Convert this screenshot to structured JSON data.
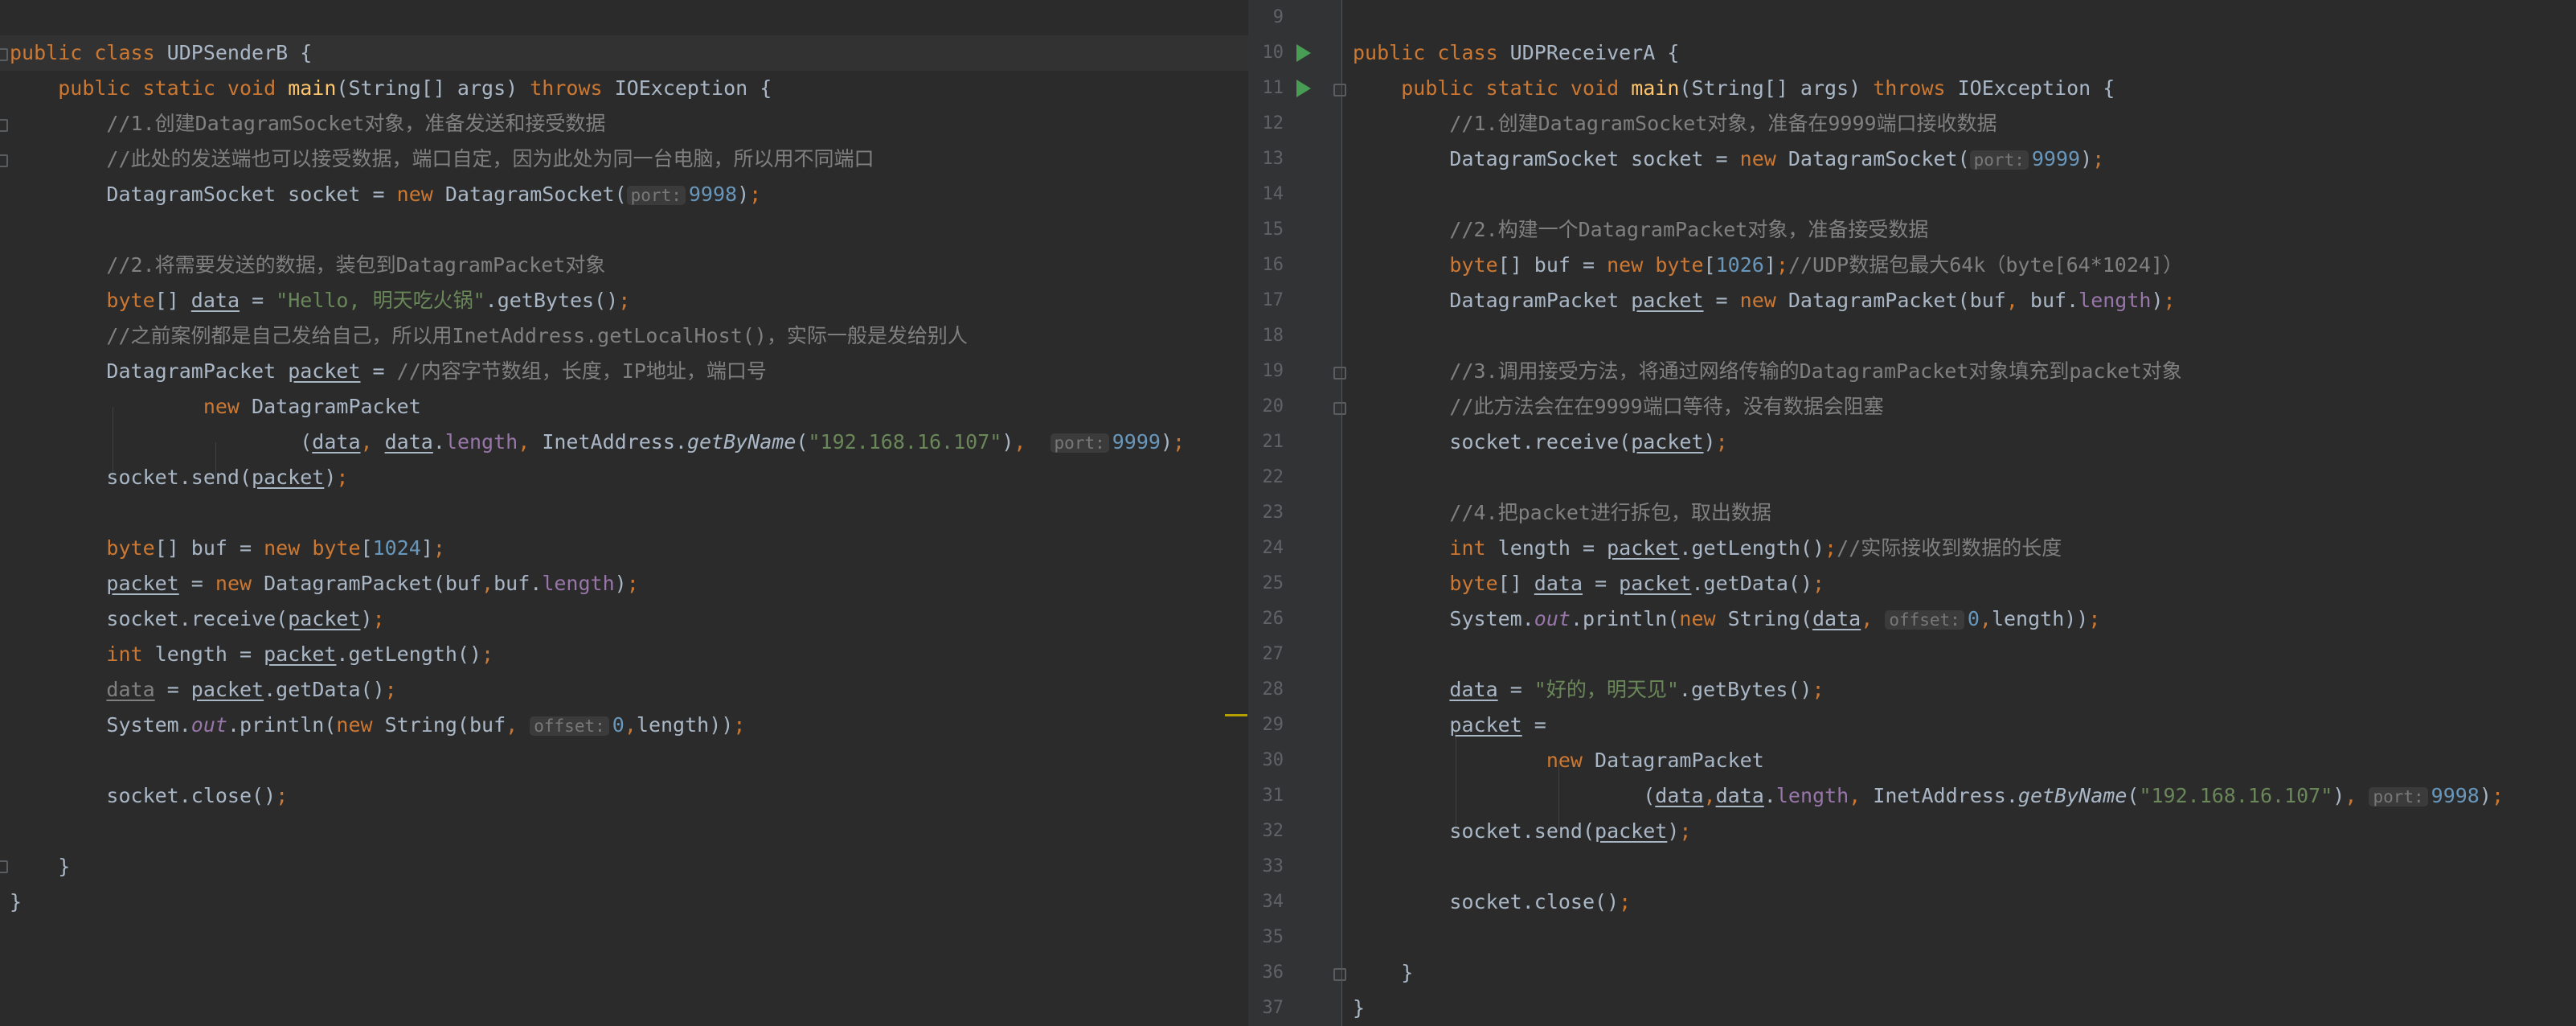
{
  "left_editor": {
    "class_name": "UDPSenderB",
    "comments": {
      "c1": "//1.创建DatagramSocket对象，准备发送和接受数据",
      "c2": "//此处的发送端也可以接受数据，端口自定，因为此处为同一台电脑，所以用不同端口",
      "c3": "//2.将需要发送的数据，装包到DatagramPacket对象",
      "c4": "//之前案例都是自己发给自己，所以用InetAddress.getLocalHost()，实际一般是发给别人",
      "c5": "//内容字节数组，长度，IP地址，端口号"
    },
    "strings": {
      "hello": "\"Hello, 明天吃火锅\"",
      "ip": "\"192.168.16.107\""
    },
    "numbers": {
      "port_socket": "9998",
      "port_send": "9999",
      "buf_size": "1024",
      "offset": "0"
    },
    "hints": {
      "port": "port:",
      "offset": "offset:"
    }
  },
  "right_editor": {
    "class_name": "UDPReceiverA",
    "line_numbers": [
      "9",
      "10",
      "11",
      "12",
      "13",
      "14",
      "15",
      "16",
      "17",
      "18",
      "19",
      "20",
      "21",
      "22",
      "23",
      "24",
      "25",
      "26",
      "27",
      "28",
      "29",
      "30",
      "31",
      "32",
      "33",
      "34",
      "35",
      "36",
      "37"
    ],
    "comments": {
      "c1": "//1.创建DatagramSocket对象，准备在9999端口接收数据",
      "c2": "//2.构建一个DatagramPacket对象，准备接受数据",
      "c3": "//UDP数据包最大64k（byte[64*1024]）",
      "c4": "//3.调用接受方法，将通过网络传输的DatagramPacket对象填充到packet对象",
      "c5": "//此方法会在在9999端口等待，没有数据会阻塞",
      "c6": "//4.把packet进行拆包，取出数据",
      "c7": "//实际接收到数据的长度"
    },
    "strings": {
      "reply": "\"好的，明天见\"",
      "ip": "\"192.168.16.107\""
    },
    "numbers": {
      "port_socket": "9999",
      "port_send": "9998",
      "buf_size": "1026",
      "offset": "0"
    },
    "hints": {
      "port": "port:",
      "offset": "offset:"
    }
  },
  "colors": {
    "background": "#2b2b2b",
    "gutter": "#313335",
    "keyword": "#cc7832",
    "method_decl": "#ffc66d",
    "string": "#6a8759",
    "number": "#6897bb",
    "comment": "#808080",
    "field": "#9876aa",
    "run_icon": "#499c54"
  }
}
